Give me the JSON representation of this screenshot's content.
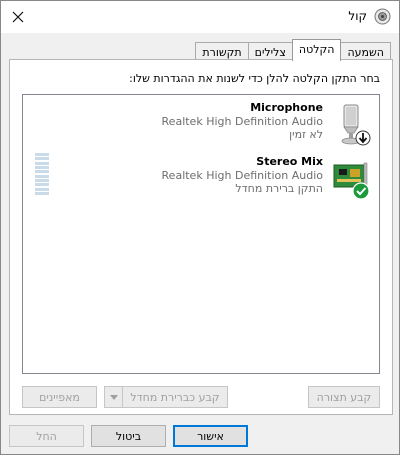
{
  "window": {
    "title": "קול",
    "icons": {
      "app": "speaker-icon",
      "close": "close-icon"
    }
  },
  "tabs": [
    {
      "label": "השמעה",
      "active": false
    },
    {
      "label": "הקלטה",
      "active": true
    },
    {
      "label": "צלילים",
      "active": false
    },
    {
      "label": "תקשורת",
      "active": false
    }
  ],
  "instruction": "בחר התקן הקלטה להלן כדי לשנות את ההגדרות שלו:",
  "devices": [
    {
      "name": "Microphone",
      "driver": "Realtek High Definition Audio",
      "status": "לא זמין",
      "icon": "microphone-icon",
      "badge": "down-arrow-badge-icon"
    },
    {
      "name": "Stereo Mix",
      "driver": "Realtek High Definition Audio",
      "status": "התקן ברירת מחדל",
      "icon": "soundcard-icon",
      "badge": "default-check-badge-icon"
    }
  ],
  "buttons": {
    "configure": "קבע תצורה",
    "set_default": "קבע כברירת מחדל",
    "properties": "מאפיינים",
    "ok": "אישור",
    "cancel": "ביטול",
    "apply": "החל"
  },
  "colors": {
    "accent": "#0078d7",
    "check_green": "#1a9a3b",
    "level_meter": "#c9dbe9"
  }
}
